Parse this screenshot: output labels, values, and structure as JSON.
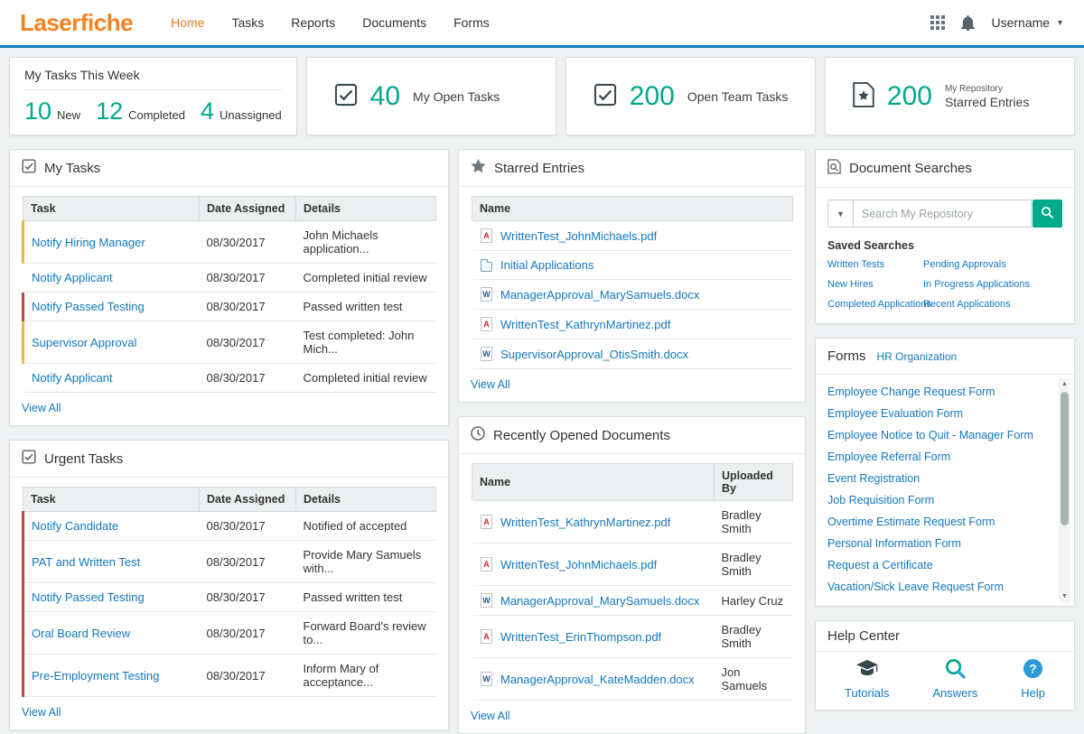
{
  "colors": {
    "brand_orange": "#f58220",
    "accent_teal": "#00a88c",
    "link_blue": "#1377bd",
    "nav_blue": "#0e7ac0",
    "alert_red": "#c64540",
    "warn_yellow": "#efb73e"
  },
  "navbar": {
    "logo": "Laserfiche",
    "items": [
      {
        "label": "Home",
        "active": true
      },
      {
        "label": "Tasks",
        "active": false
      },
      {
        "label": "Reports",
        "active": false
      },
      {
        "label": "Documents",
        "active": false
      },
      {
        "label": "Forms",
        "active": false
      }
    ],
    "username": "Username",
    "icons": [
      "app-grid-icon",
      "notifications-bell-icon",
      "chevron-down-icon"
    ]
  },
  "summary": {
    "week": {
      "title": "My Tasks This Week",
      "stats": [
        {
          "value": "10",
          "label": "New"
        },
        {
          "value": "12",
          "label": "Completed"
        },
        {
          "value": "4",
          "label": "Unassigned"
        }
      ]
    },
    "open_tasks": {
      "value": "40",
      "label": "My Open Tasks",
      "icon": "check-square-icon"
    },
    "team_tasks": {
      "value": "200",
      "label": "Open Team Tasks",
      "icon": "check-square-icon"
    },
    "starred": {
      "value": "200",
      "label_small": "My Repository",
      "label": "Starred Entries",
      "icon": "starred-document-icon"
    }
  },
  "my_tasks": {
    "title": "My Tasks",
    "icon": "check-square-icon",
    "headers": {
      "task": "Task",
      "date": "Date Assigned",
      "details": "Details"
    },
    "rows": [
      {
        "task": "Notify Hiring Manager",
        "date": "08/30/2017",
        "details": "John Michaels application...",
        "accent": "yellow"
      },
      {
        "task": "Notify Applicant",
        "date": "08/30/2017",
        "details": "Completed initial review",
        "accent": "none"
      },
      {
        "task": "Notify Passed Testing",
        "date": "08/30/2017",
        "details": "Passed written test",
        "accent": "red"
      },
      {
        "task": "Supervisor Approval",
        "date": "08/30/2017",
        "details": "Test completed: John Mich...",
        "accent": "yellow"
      },
      {
        "task": "Notify Applicant",
        "date": "08/30/2017",
        "details": "Completed initial review",
        "accent": "none"
      }
    ],
    "view_all": "View All"
  },
  "urgent_tasks": {
    "title": "Urgent Tasks",
    "icon": "check-square-icon",
    "headers": {
      "task": "Task",
      "date": "Date Assigned",
      "details": "Details"
    },
    "rows": [
      {
        "task": "Notify Candidate",
        "date": "08/30/2017",
        "details": "Notified of accepted",
        "accent": "red"
      },
      {
        "task": "PAT and Written Test",
        "date": "08/30/2017",
        "details": "Provide Mary Samuels with...",
        "accent": "red"
      },
      {
        "task": "Notify Passed Testing",
        "date": "08/30/2017",
        "details": "Passed written test",
        "accent": "red"
      },
      {
        "task": "Oral Board Review",
        "date": "08/30/2017",
        "details": "Forward Board's review to...",
        "accent": "red"
      },
      {
        "task": "Pre-Employment Testing",
        "date": "08/30/2017",
        "details": "Inform Mary of acceptance...",
        "accent": "red"
      }
    ],
    "view_all": "View All"
  },
  "starred_entries": {
    "title": "Starred Entries",
    "icon": "star-icon",
    "header": "Name",
    "rows": [
      {
        "name": "WrittenTest_JohnMichaels.pdf",
        "icon": "pdf-file-icon"
      },
      {
        "name": "Initial Applications",
        "icon": "folder-icon"
      },
      {
        "name": "ManagerApproval_MarySamuels.docx",
        "icon": "word-file-icon"
      },
      {
        "name": "WrittenTest_KathrynMartinez.pdf",
        "icon": "pdf-file-icon"
      },
      {
        "name": "SupervisorApproval_OtisSmith.docx",
        "icon": "word-file-icon"
      }
    ],
    "view_all": "View All"
  },
  "recent_documents": {
    "title": "Recently Opened Documents",
    "icon": "clock-icon",
    "headers": {
      "name": "Name",
      "uploaded_by": "Uploaded By"
    },
    "rows": [
      {
        "name": "WrittenTest_KathrynMartinez.pdf",
        "icon": "pdf-file-icon",
        "uploaded_by": "Bradley Smith"
      },
      {
        "name": "WrittenTest_JohnMichaels.pdf",
        "icon": "pdf-file-icon",
        "uploaded_by": "Bradley Smith"
      },
      {
        "name": "ManagerApproval_MarySamuels.docx",
        "icon": "word-file-icon",
        "uploaded_by": "Harley Cruz"
      },
      {
        "name": "WrittenTest_ErinThompson.pdf",
        "icon": "pdf-file-icon",
        "uploaded_by": "Bradley Smith"
      },
      {
        "name": "ManagerApproval_KateMadden.docx",
        "icon": "word-file-icon",
        "uploaded_by": "Jon Samuels"
      }
    ],
    "view_all": "View All"
  },
  "document_searches": {
    "title": "Document Searches",
    "icon": "document-search-icon",
    "search_placeholder": "Search My Repository",
    "saved_title": "Saved Searches",
    "links_left": [
      "Written Tests",
      "New Hires",
      "Completed Applications"
    ],
    "links_right": [
      "Pending Approvals",
      "In Progress Applications",
      "Recent Applications"
    ]
  },
  "forms_panel": {
    "title": "Forms",
    "org_link": "HR Organization",
    "links": [
      "Employee Change Request Form",
      "Employee Evaluation Form",
      "Employee Notice to Quit - Manager Form",
      "Employee Referral Form",
      "Event Registration",
      "Job Requisition Form",
      "Overtime Estimate Request Form",
      "Personal Information Form",
      "Request a Certificate",
      "Vacation/Sick Leave Request Form"
    ]
  },
  "help_center": {
    "title": "Help Center",
    "items": [
      {
        "label": "Tutorials",
        "icon": "tutorials-graduation-cap-icon"
      },
      {
        "label": "Answers",
        "icon": "answers-magnifier-icon"
      },
      {
        "label": "Help",
        "icon": "help-question-icon"
      }
    ]
  }
}
